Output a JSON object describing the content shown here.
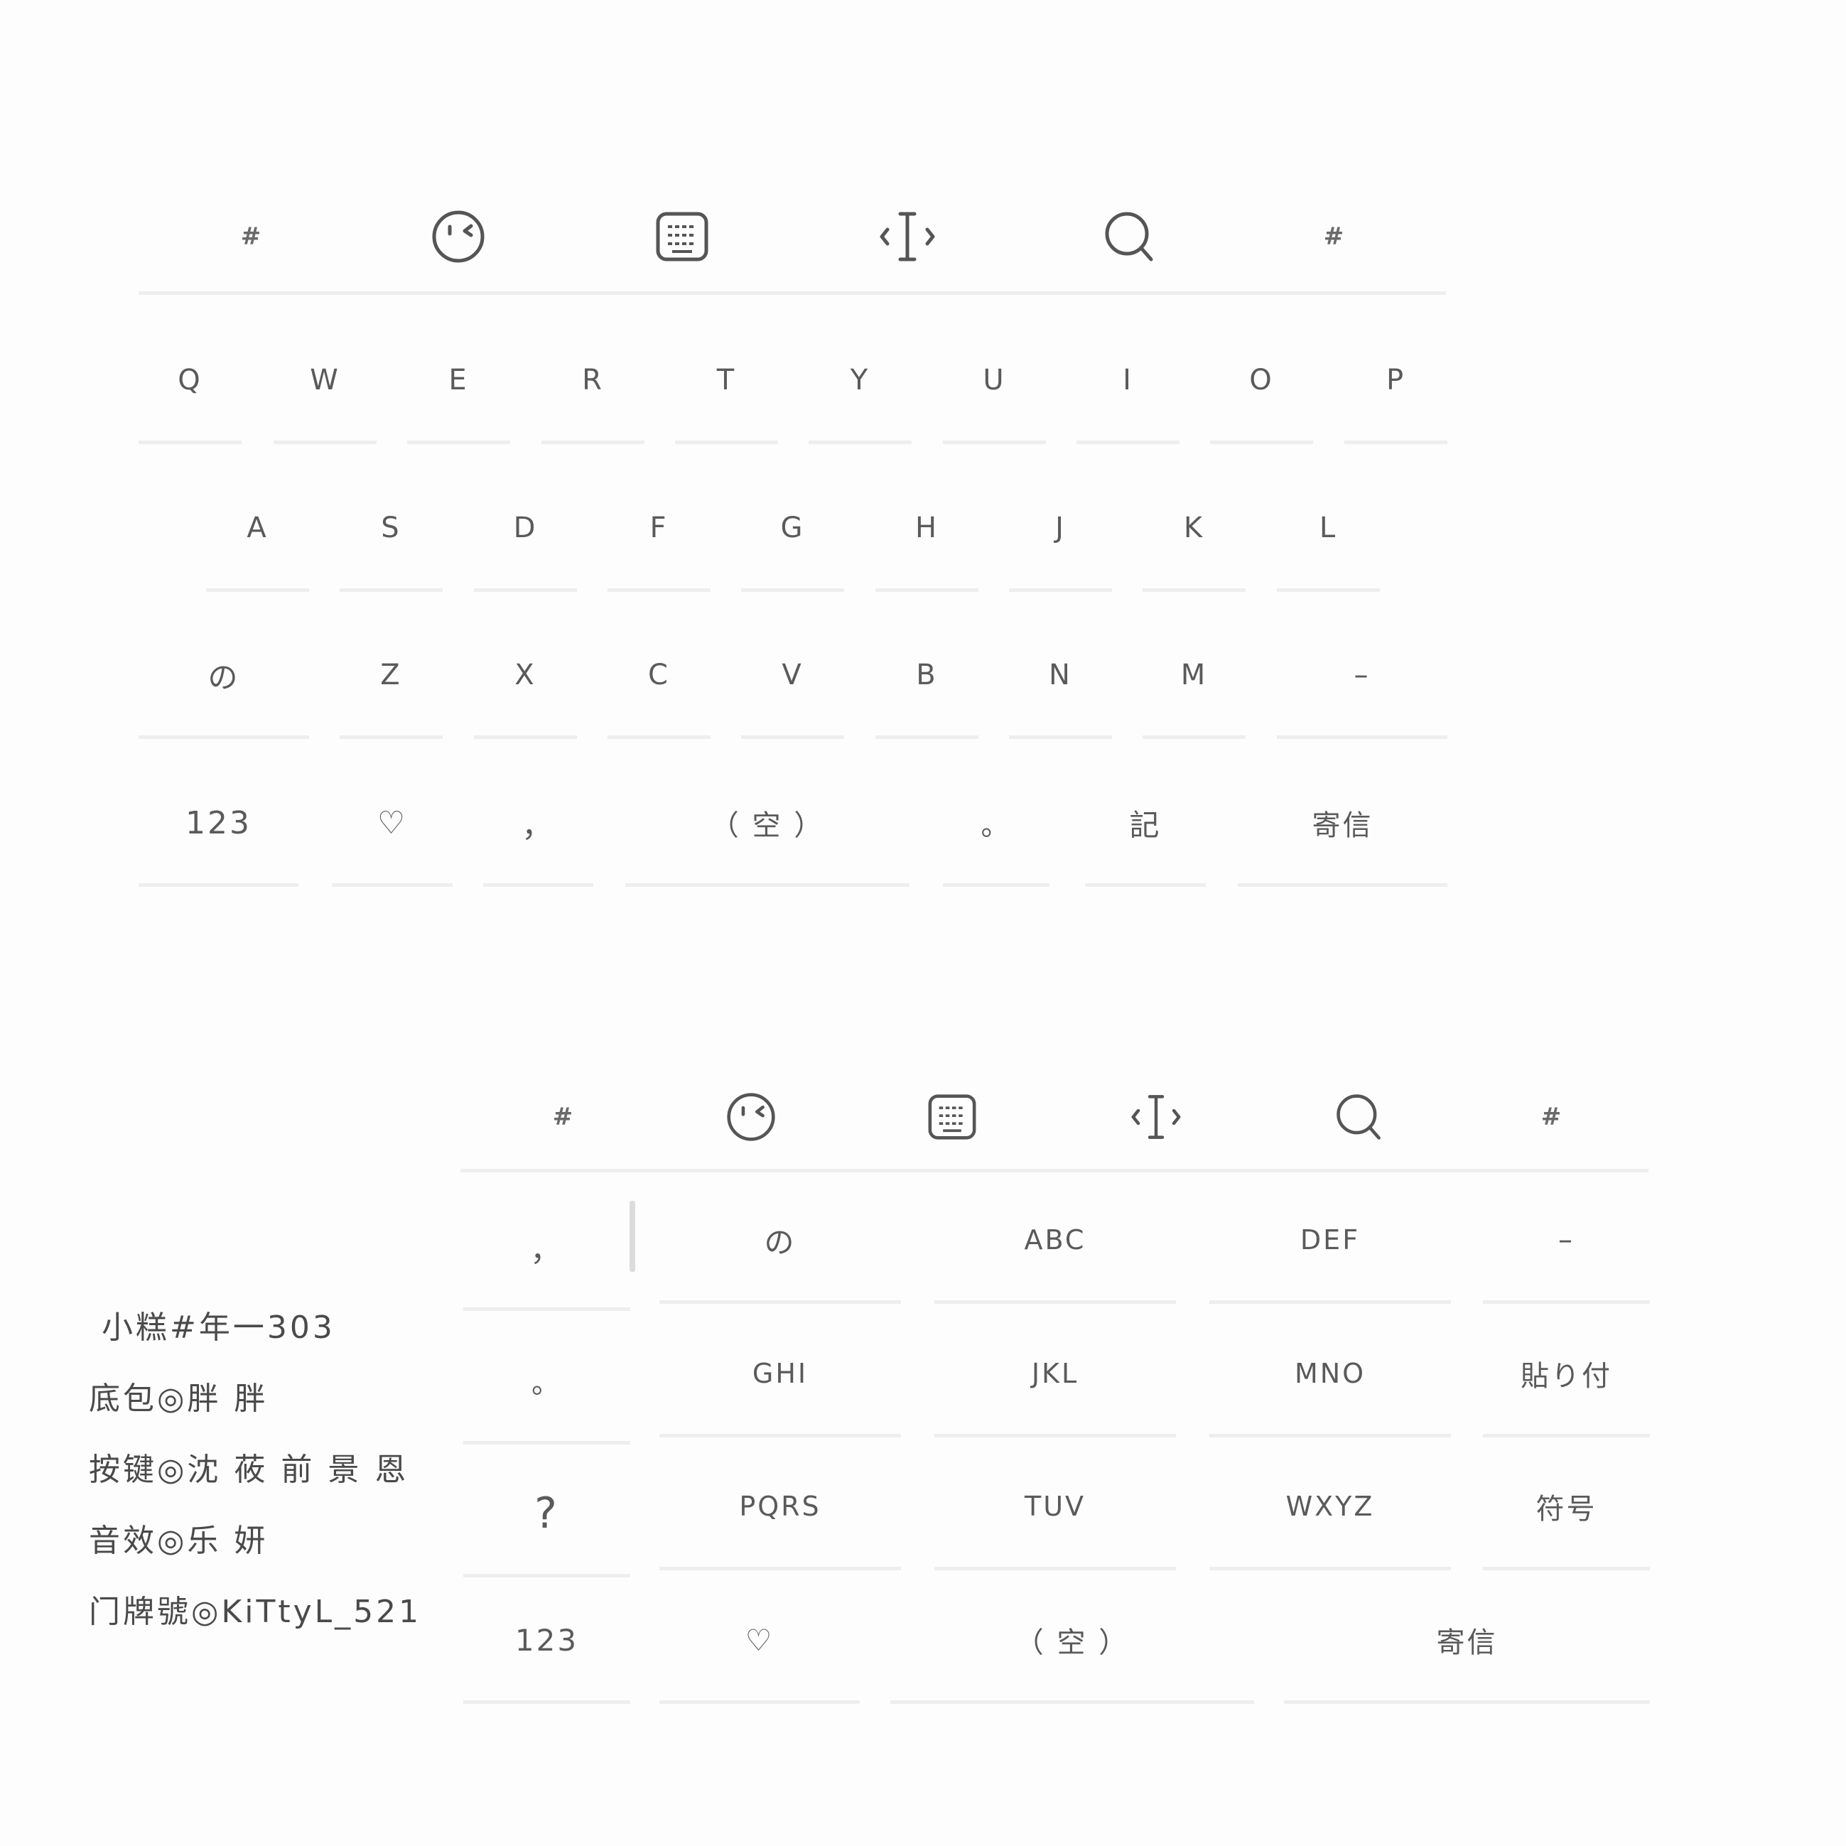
{
  "keyboard_qwerty": {
    "toolbar": {
      "left_hash": "#",
      "right_hash": "#",
      "icons": [
        "emoji-face-icon",
        "keyboard-icon",
        "cursor-icon",
        "search-icon"
      ]
    },
    "row1": [
      "Q",
      "W",
      "E",
      "R",
      "T",
      "Y",
      "U",
      "I",
      "O",
      "P"
    ],
    "row2": [
      "A",
      "S",
      "D",
      "F",
      "G",
      "H",
      "J",
      "K",
      "L"
    ],
    "row3": [
      "の",
      "Z",
      "X",
      "C",
      "V",
      "B",
      "N",
      "M",
      "–"
    ],
    "row4": {
      "num": "123",
      "heart": "♡",
      "comma": "，",
      "space": "（ 空 ）",
      "period": "。",
      "symbol": "記",
      "send": "寄信"
    }
  },
  "keyboard_t9": {
    "toolbar": {
      "left_hash": "#",
      "right_hash": "#",
      "icons": [
        "emoji-face-icon",
        "keyboard-icon",
        "cursor-icon",
        "search-icon"
      ]
    },
    "side_keys": [
      "，",
      "。",
      "?"
    ],
    "row1": [
      "の",
      "ABC",
      "DEF",
      "–"
    ],
    "row2": [
      "GHI",
      "JKL",
      "MNO",
      "貼り付"
    ],
    "row3": [
      "PQRS",
      "TUV",
      "WXYZ",
      "符号"
    ],
    "row4": {
      "num": "123",
      "heart": "♡",
      "space": "（ 空 ）",
      "send": "寄信"
    }
  },
  "credits": [
    "小糕#年一303",
    "底包◎胖 胖",
    "按键◎沈 莜 前 景 恩",
    "音效◎乐 妍",
    "门牌號◎KiTtyL_521"
  ],
  "colors": {
    "background": "#fdfdfd",
    "key_text": "#5a5a5a",
    "key_underline": "#eeeeee"
  }
}
